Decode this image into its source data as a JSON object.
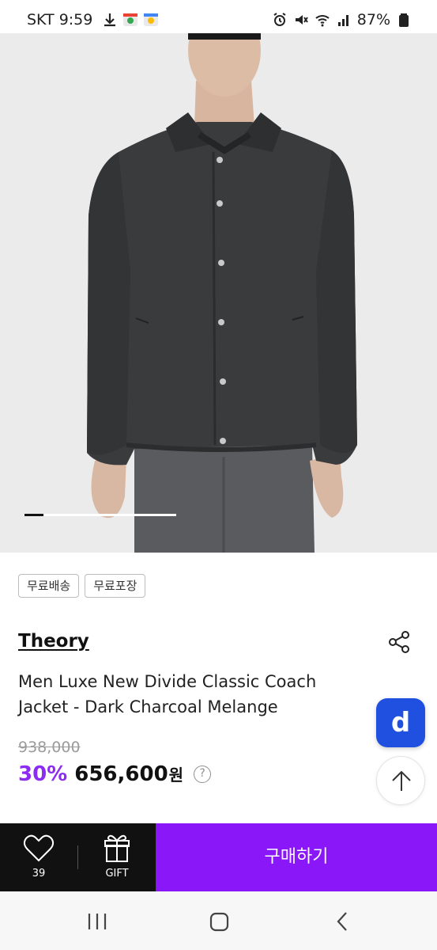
{
  "status_bar": {
    "carrier_time": "SKT 9:59",
    "battery": "87%"
  },
  "gallery": {
    "progress": 0.125
  },
  "tags": [
    "무료배송",
    "무료포장"
  ],
  "product": {
    "brand": "Theory",
    "title": "Men Luxe New Divide Classic Coach Jacket - Dark Charcoal Melange",
    "original_price": "938,000",
    "discount": "30%",
    "price": "656,600",
    "currency": "원",
    "help": "?"
  },
  "floating": {
    "app_button": "d"
  },
  "bottom_bar": {
    "like_count": "39",
    "gift_label": "GIFT",
    "buy_label": "구매하기"
  },
  "colors": {
    "accent": "#8a17f7",
    "discount": "#8b2cf0",
    "app_button": "#1f50e0"
  }
}
